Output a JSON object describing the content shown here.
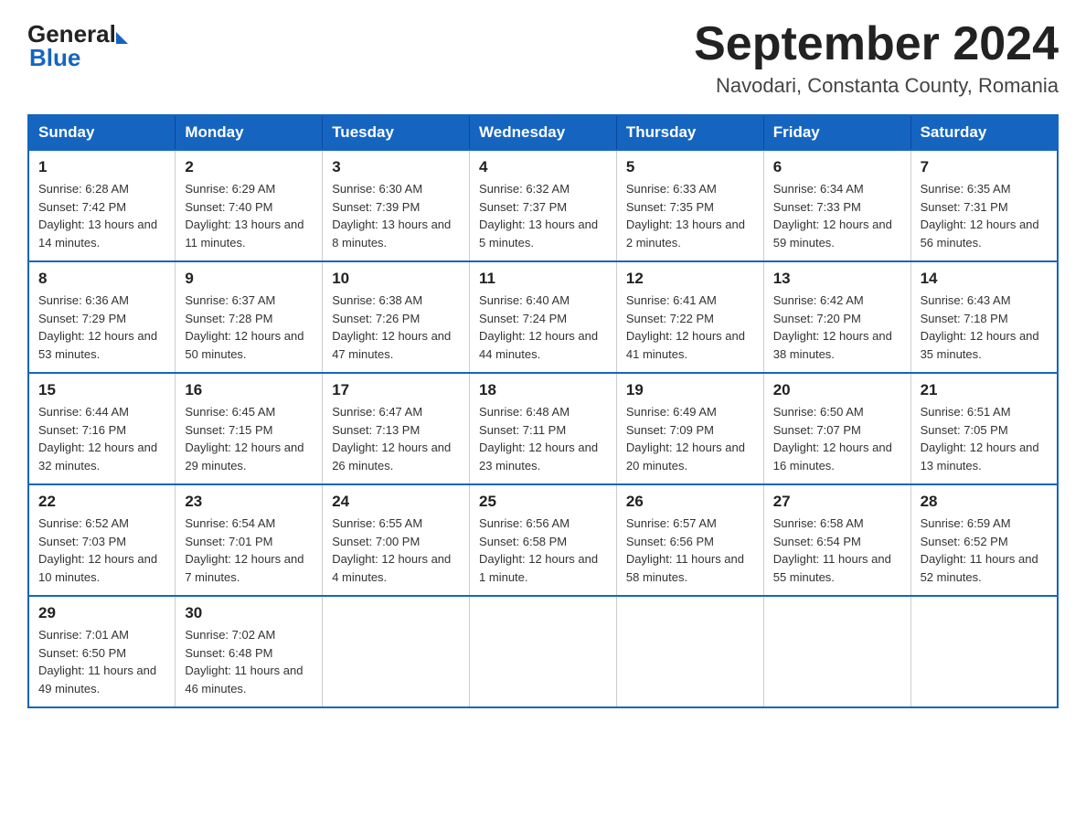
{
  "header": {
    "logo_general": "General",
    "logo_blue": "Blue",
    "title": "September 2024",
    "subtitle": "Navodari, Constanta County, Romania"
  },
  "days_of_week": [
    "Sunday",
    "Monday",
    "Tuesday",
    "Wednesday",
    "Thursday",
    "Friday",
    "Saturday"
  ],
  "weeks": [
    [
      {
        "day": "1",
        "sunrise": "Sunrise: 6:28 AM",
        "sunset": "Sunset: 7:42 PM",
        "daylight": "Daylight: 13 hours and 14 minutes."
      },
      {
        "day": "2",
        "sunrise": "Sunrise: 6:29 AM",
        "sunset": "Sunset: 7:40 PM",
        "daylight": "Daylight: 13 hours and 11 minutes."
      },
      {
        "day": "3",
        "sunrise": "Sunrise: 6:30 AM",
        "sunset": "Sunset: 7:39 PM",
        "daylight": "Daylight: 13 hours and 8 minutes."
      },
      {
        "day": "4",
        "sunrise": "Sunrise: 6:32 AM",
        "sunset": "Sunset: 7:37 PM",
        "daylight": "Daylight: 13 hours and 5 minutes."
      },
      {
        "day": "5",
        "sunrise": "Sunrise: 6:33 AM",
        "sunset": "Sunset: 7:35 PM",
        "daylight": "Daylight: 13 hours and 2 minutes."
      },
      {
        "day": "6",
        "sunrise": "Sunrise: 6:34 AM",
        "sunset": "Sunset: 7:33 PM",
        "daylight": "Daylight: 12 hours and 59 minutes."
      },
      {
        "day": "7",
        "sunrise": "Sunrise: 6:35 AM",
        "sunset": "Sunset: 7:31 PM",
        "daylight": "Daylight: 12 hours and 56 minutes."
      }
    ],
    [
      {
        "day": "8",
        "sunrise": "Sunrise: 6:36 AM",
        "sunset": "Sunset: 7:29 PM",
        "daylight": "Daylight: 12 hours and 53 minutes."
      },
      {
        "day": "9",
        "sunrise": "Sunrise: 6:37 AM",
        "sunset": "Sunset: 7:28 PM",
        "daylight": "Daylight: 12 hours and 50 minutes."
      },
      {
        "day": "10",
        "sunrise": "Sunrise: 6:38 AM",
        "sunset": "Sunset: 7:26 PM",
        "daylight": "Daylight: 12 hours and 47 minutes."
      },
      {
        "day": "11",
        "sunrise": "Sunrise: 6:40 AM",
        "sunset": "Sunset: 7:24 PM",
        "daylight": "Daylight: 12 hours and 44 minutes."
      },
      {
        "day": "12",
        "sunrise": "Sunrise: 6:41 AM",
        "sunset": "Sunset: 7:22 PM",
        "daylight": "Daylight: 12 hours and 41 minutes."
      },
      {
        "day": "13",
        "sunrise": "Sunrise: 6:42 AM",
        "sunset": "Sunset: 7:20 PM",
        "daylight": "Daylight: 12 hours and 38 minutes."
      },
      {
        "day": "14",
        "sunrise": "Sunrise: 6:43 AM",
        "sunset": "Sunset: 7:18 PM",
        "daylight": "Daylight: 12 hours and 35 minutes."
      }
    ],
    [
      {
        "day": "15",
        "sunrise": "Sunrise: 6:44 AM",
        "sunset": "Sunset: 7:16 PM",
        "daylight": "Daylight: 12 hours and 32 minutes."
      },
      {
        "day": "16",
        "sunrise": "Sunrise: 6:45 AM",
        "sunset": "Sunset: 7:15 PM",
        "daylight": "Daylight: 12 hours and 29 minutes."
      },
      {
        "day": "17",
        "sunrise": "Sunrise: 6:47 AM",
        "sunset": "Sunset: 7:13 PM",
        "daylight": "Daylight: 12 hours and 26 minutes."
      },
      {
        "day": "18",
        "sunrise": "Sunrise: 6:48 AM",
        "sunset": "Sunset: 7:11 PM",
        "daylight": "Daylight: 12 hours and 23 minutes."
      },
      {
        "day": "19",
        "sunrise": "Sunrise: 6:49 AM",
        "sunset": "Sunset: 7:09 PM",
        "daylight": "Daylight: 12 hours and 20 minutes."
      },
      {
        "day": "20",
        "sunrise": "Sunrise: 6:50 AM",
        "sunset": "Sunset: 7:07 PM",
        "daylight": "Daylight: 12 hours and 16 minutes."
      },
      {
        "day": "21",
        "sunrise": "Sunrise: 6:51 AM",
        "sunset": "Sunset: 7:05 PM",
        "daylight": "Daylight: 12 hours and 13 minutes."
      }
    ],
    [
      {
        "day": "22",
        "sunrise": "Sunrise: 6:52 AM",
        "sunset": "Sunset: 7:03 PM",
        "daylight": "Daylight: 12 hours and 10 minutes."
      },
      {
        "day": "23",
        "sunrise": "Sunrise: 6:54 AM",
        "sunset": "Sunset: 7:01 PM",
        "daylight": "Daylight: 12 hours and 7 minutes."
      },
      {
        "day": "24",
        "sunrise": "Sunrise: 6:55 AM",
        "sunset": "Sunset: 7:00 PM",
        "daylight": "Daylight: 12 hours and 4 minutes."
      },
      {
        "day": "25",
        "sunrise": "Sunrise: 6:56 AM",
        "sunset": "Sunset: 6:58 PM",
        "daylight": "Daylight: 12 hours and 1 minute."
      },
      {
        "day": "26",
        "sunrise": "Sunrise: 6:57 AM",
        "sunset": "Sunset: 6:56 PM",
        "daylight": "Daylight: 11 hours and 58 minutes."
      },
      {
        "day": "27",
        "sunrise": "Sunrise: 6:58 AM",
        "sunset": "Sunset: 6:54 PM",
        "daylight": "Daylight: 11 hours and 55 minutes."
      },
      {
        "day": "28",
        "sunrise": "Sunrise: 6:59 AM",
        "sunset": "Sunset: 6:52 PM",
        "daylight": "Daylight: 11 hours and 52 minutes."
      }
    ],
    [
      {
        "day": "29",
        "sunrise": "Sunrise: 7:01 AM",
        "sunset": "Sunset: 6:50 PM",
        "daylight": "Daylight: 11 hours and 49 minutes."
      },
      {
        "day": "30",
        "sunrise": "Sunrise: 7:02 AM",
        "sunset": "Sunset: 6:48 PM",
        "daylight": "Daylight: 11 hours and 46 minutes."
      },
      null,
      null,
      null,
      null,
      null
    ]
  ]
}
